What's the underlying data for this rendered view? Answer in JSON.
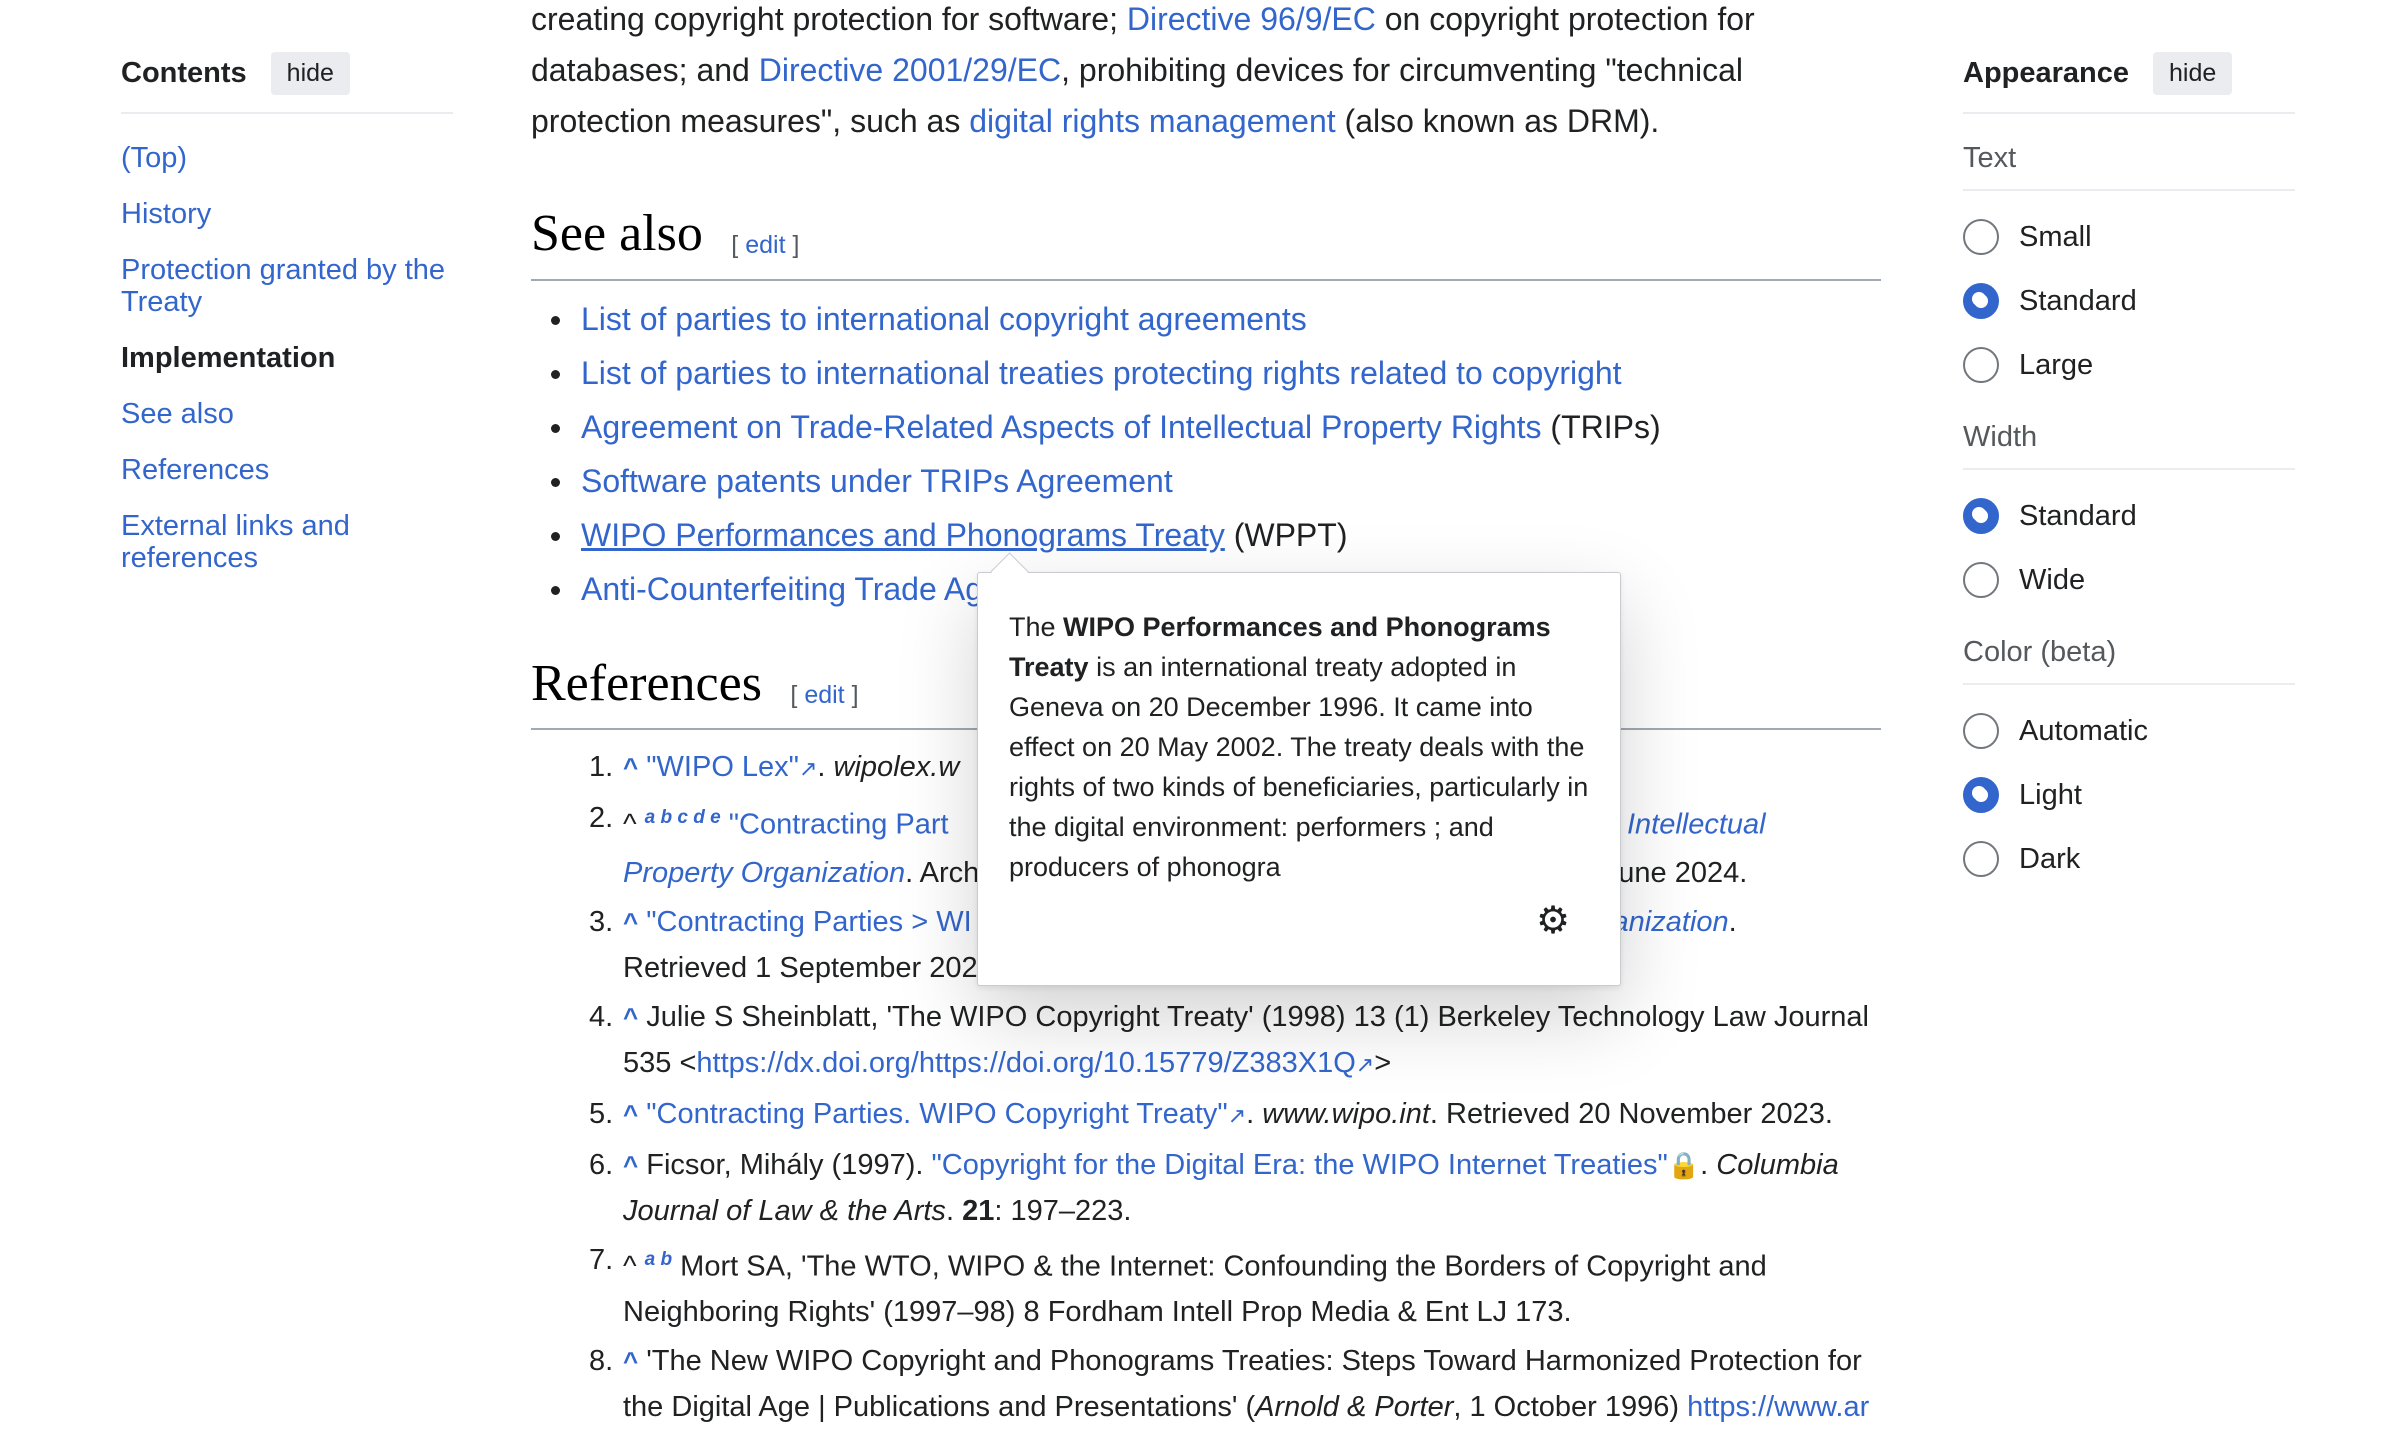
{
  "toc": {
    "title": "Contents",
    "hide": "hide",
    "items": [
      {
        "label": "(Top)"
      },
      {
        "label": "History"
      },
      {
        "label": "Protection granted by the Treaty"
      },
      {
        "label": "Implementation"
      },
      {
        "label": "See also"
      },
      {
        "label": "References"
      },
      {
        "label": "External links and references"
      }
    ]
  },
  "intro": {
    "t1": "creating copyright protection for software; ",
    "l1": "Directive 96/9/EC",
    "t2": " on copyright protection for databases; and ",
    "l2": "Directive 2001/29/EC",
    "t3": ", prohibiting devices for circumventing \"technical protection measures\", such as ",
    "l3": "digital rights management",
    "t4": " (also known as DRM)."
  },
  "see_also": {
    "heading": "See also",
    "edit_open": "[ ",
    "edit": "edit",
    "edit_close": " ]",
    "items": [
      {
        "link": "List of parties to international copyright agreements",
        "suffix": ""
      },
      {
        "link": "List of parties to international treaties protecting rights related to copyright",
        "suffix": ""
      },
      {
        "link": "Agreement on Trade-Related Aspects of Intellectual Property Rights",
        "suffix": " (TRIPs)"
      },
      {
        "link": "Software patents under TRIPs Agreement",
        "suffix": ""
      },
      {
        "link": "WIPO Performances and Phonograms Treaty",
        "suffix": " (WPPT)"
      },
      {
        "link": "Anti-Counterfeiting Trade Ag",
        "suffix": ""
      }
    ]
  },
  "references": {
    "heading": "References",
    "edit": "edit",
    "r1": {
      "num": "1.",
      "caret": "^",
      "link": "\"WIPO Lex\"",
      "ext": "↗",
      "text": ". ",
      "ital": "wipolex.w"
    },
    "r2": {
      "num": "2.",
      "caret": "^",
      "sup": "a b c d e",
      "link": "\"Contracting Part",
      "ext": "↗",
      "text1": ". ",
      "ital_link": "World Intellectual Property Organization",
      "text2": ". Arch",
      "text3": "ed 4 June 2024."
    },
    "r3": {
      "num": "3.",
      "caret": "^",
      "link": "\"Contracting Parties > WI",
      "ital_link": "y Organization",
      "text": ".",
      "line2": "Retrieved 1 September 202"
    },
    "r4": {
      "num": "4.",
      "caret": "^",
      "text": " Julie S Sheinblatt, 'The WIPO Copyright Treaty' (1998) 13 (1) Berkeley Technology Law Journal 535 <",
      "link": "https://dx.doi.org/https://doi.org/10.15779/Z383X1Q",
      "ext": "↗",
      "end": ">"
    },
    "r5": {
      "num": "5.",
      "caret": "^",
      "link": "\"Contracting Parties. WIPO Copyright Treaty\"",
      "ext": "↗",
      "text1": ". ",
      "ital": "www.wipo.int",
      "text2": ". Retrieved 20 November 2023."
    },
    "r6": {
      "num": "6.",
      "caret": "^",
      "text1": " Ficsor, Mihály (1997). ",
      "link": "\"Copyright for the Digital Era: the WIPO Internet Treaties\"",
      "lock": "🔒",
      "text2": ". ",
      "ital": "Columbia Journal of Law & the Arts",
      "text3": ". ",
      "bold": "21",
      "text4": ": 197–223."
    },
    "r7": {
      "num": "7.",
      "caret": "^",
      "sup": "a b",
      "text": " Mort SA, 'The WTO, WIPO & the Internet: Confounding the Borders of Copyright and Neighboring Rights' (1997–98) 8 Fordham Intell Prop Media & Ent LJ 173."
    },
    "r8": {
      "num": "8.",
      "caret": "^",
      "text1": " 'The New WIPO Copyright and Phonograms Treaties: Steps Toward Harmonized Protection for the Digital Age | Publications and Presentations' (",
      "ital": "Arnold & Porter",
      "text2": ", 1 October 1996) ",
      "link": "https://www.ar"
    }
  },
  "popup": {
    "t1": "The ",
    "b1": "WIPO Performances and Phonograms Treaty",
    "t2": " is an international treaty adopted in Geneva on 20 December 1996. It came into effect on 20 May 2002. The treaty deals with the rights of two kinds of beneficiaries, particularly in the digital environment: performers ; and producers of phonogra",
    "settings_icon": "⚙"
  },
  "appearance": {
    "title": "Appearance",
    "hide": "hide",
    "text_label": "Text",
    "text_options": [
      "Small",
      "Standard",
      "Large"
    ],
    "text_selected": "Standard",
    "width_label": "Width",
    "width_options": [
      "Standard",
      "Wide"
    ],
    "width_selected": "Standard",
    "color_label": "Color (beta)",
    "color_options": [
      "Automatic",
      "Light",
      "Dark"
    ],
    "color_selected": "Light"
  }
}
